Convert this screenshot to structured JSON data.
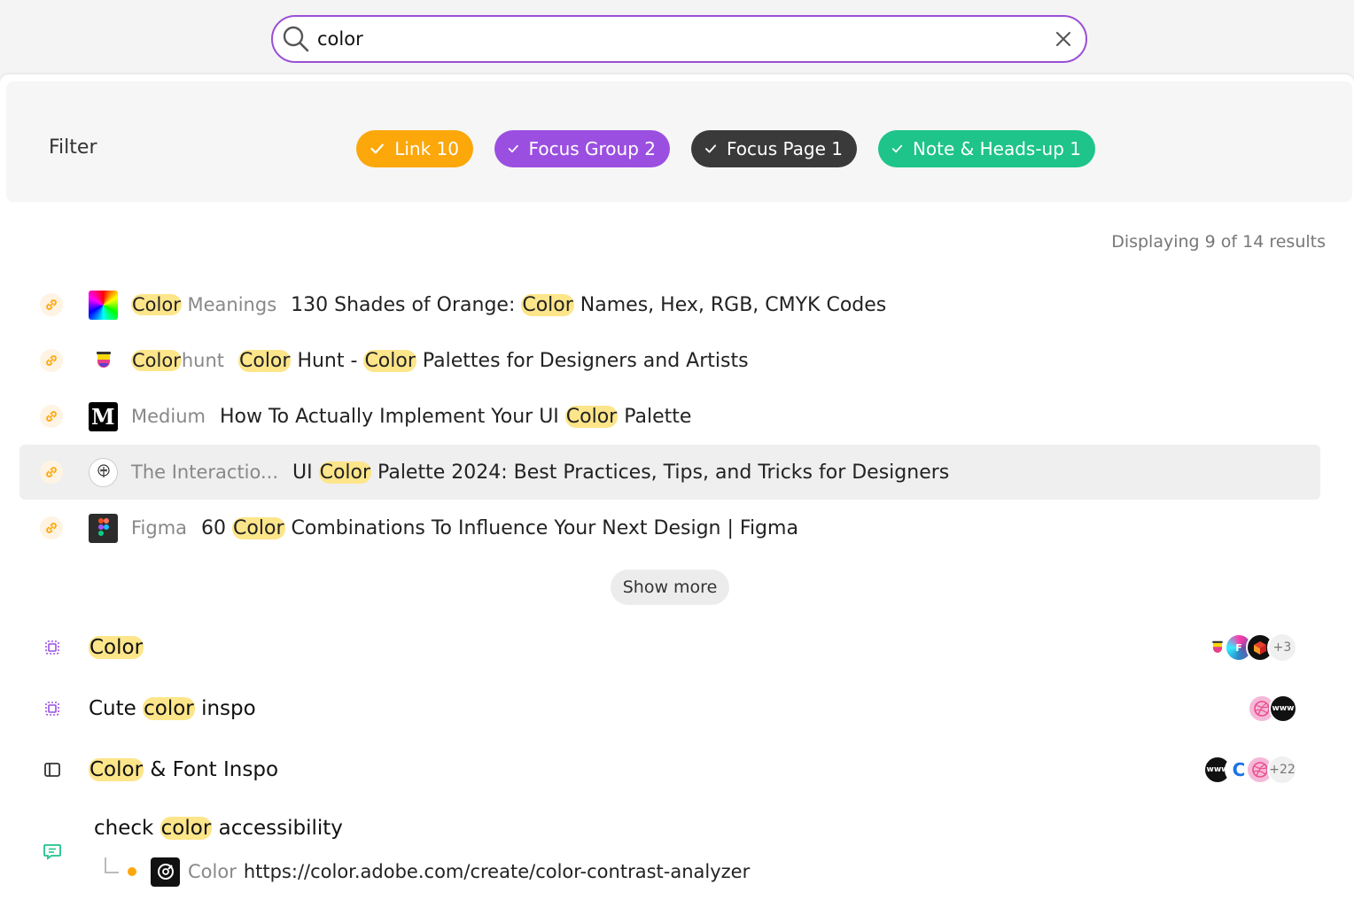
{
  "search": {
    "value": "color",
    "placeholder": ""
  },
  "filter": {
    "label": "Filter",
    "chips": [
      {
        "label": "Link 10",
        "color": "#fca70a"
      },
      {
        "label": "Focus Group 2",
        "color": "#9b4fe0"
      },
      {
        "label": "Focus Page 1",
        "color": "#3a3a3a"
      },
      {
        "label": "Note & Heads-up 1",
        "color": "#1ec48a"
      }
    ]
  },
  "results_count": "Displaying 9 of 14 results",
  "highlight_color": "#fde58a",
  "links": [
    {
      "site_pre": "",
      "site_hl": "Color",
      "site_post": " Meanings",
      "t1": "130 Shades of Orange: ",
      "t2": "Color",
      "t3": " Names, Hex, RGB, CMYK Codes",
      "t4": "",
      "t5": "",
      "favicon": "color-wheel-icon"
    },
    {
      "site_pre": "",
      "site_hl": "Color",
      "site_post": "hunt",
      "t1": "",
      "t2": "Color",
      "t3": " Hunt - ",
      "t4": "Color",
      "t5": " Palettes for Designers and Artists",
      "favicon": "colorhunt-icon"
    },
    {
      "site_pre": "Medium",
      "site_hl": "",
      "site_post": "",
      "t1": "How To Actually Implement Your UI ",
      "t2": "Color",
      "t3": " Palette",
      "t4": "",
      "t5": "",
      "favicon": "medium-icon"
    },
    {
      "site_pre": "The Interactio...",
      "site_hl": "",
      "site_post": "",
      "t1": "UI ",
      "t2": "Color",
      "t3": " Palette 2024: Best Practices, Tips, and Tricks for Designers",
      "t4": "",
      "t5": "",
      "favicon": "ixdf-icon"
    },
    {
      "site_pre": "Figma",
      "site_hl": "",
      "site_post": "",
      "t1": "60 ",
      "t2": "Color",
      "t3": " Combinations To Influence Your Next Design | Figma",
      "t4": "",
      "t5": "",
      "favicon": "figma-icon"
    }
  ],
  "show_more_label": "Show more",
  "groups": [
    {
      "pre": "",
      "hl": "Color",
      "post": "",
      "more": "+3",
      "type": "focus-group"
    },
    {
      "pre": "Cute ",
      "hl": "color",
      "post": " inspo",
      "more": "",
      "type": "focus-group"
    },
    {
      "pre": "",
      "hl": "Color",
      "post": " & Font Inspo",
      "more": "+22",
      "type": "focus-page"
    }
  ],
  "note": {
    "pre": "check ",
    "hl": "color",
    "post": " accessibility",
    "link_site": "Color",
    "link_url": "https://color.adobe.com/create/color-contrast-analyzer"
  }
}
